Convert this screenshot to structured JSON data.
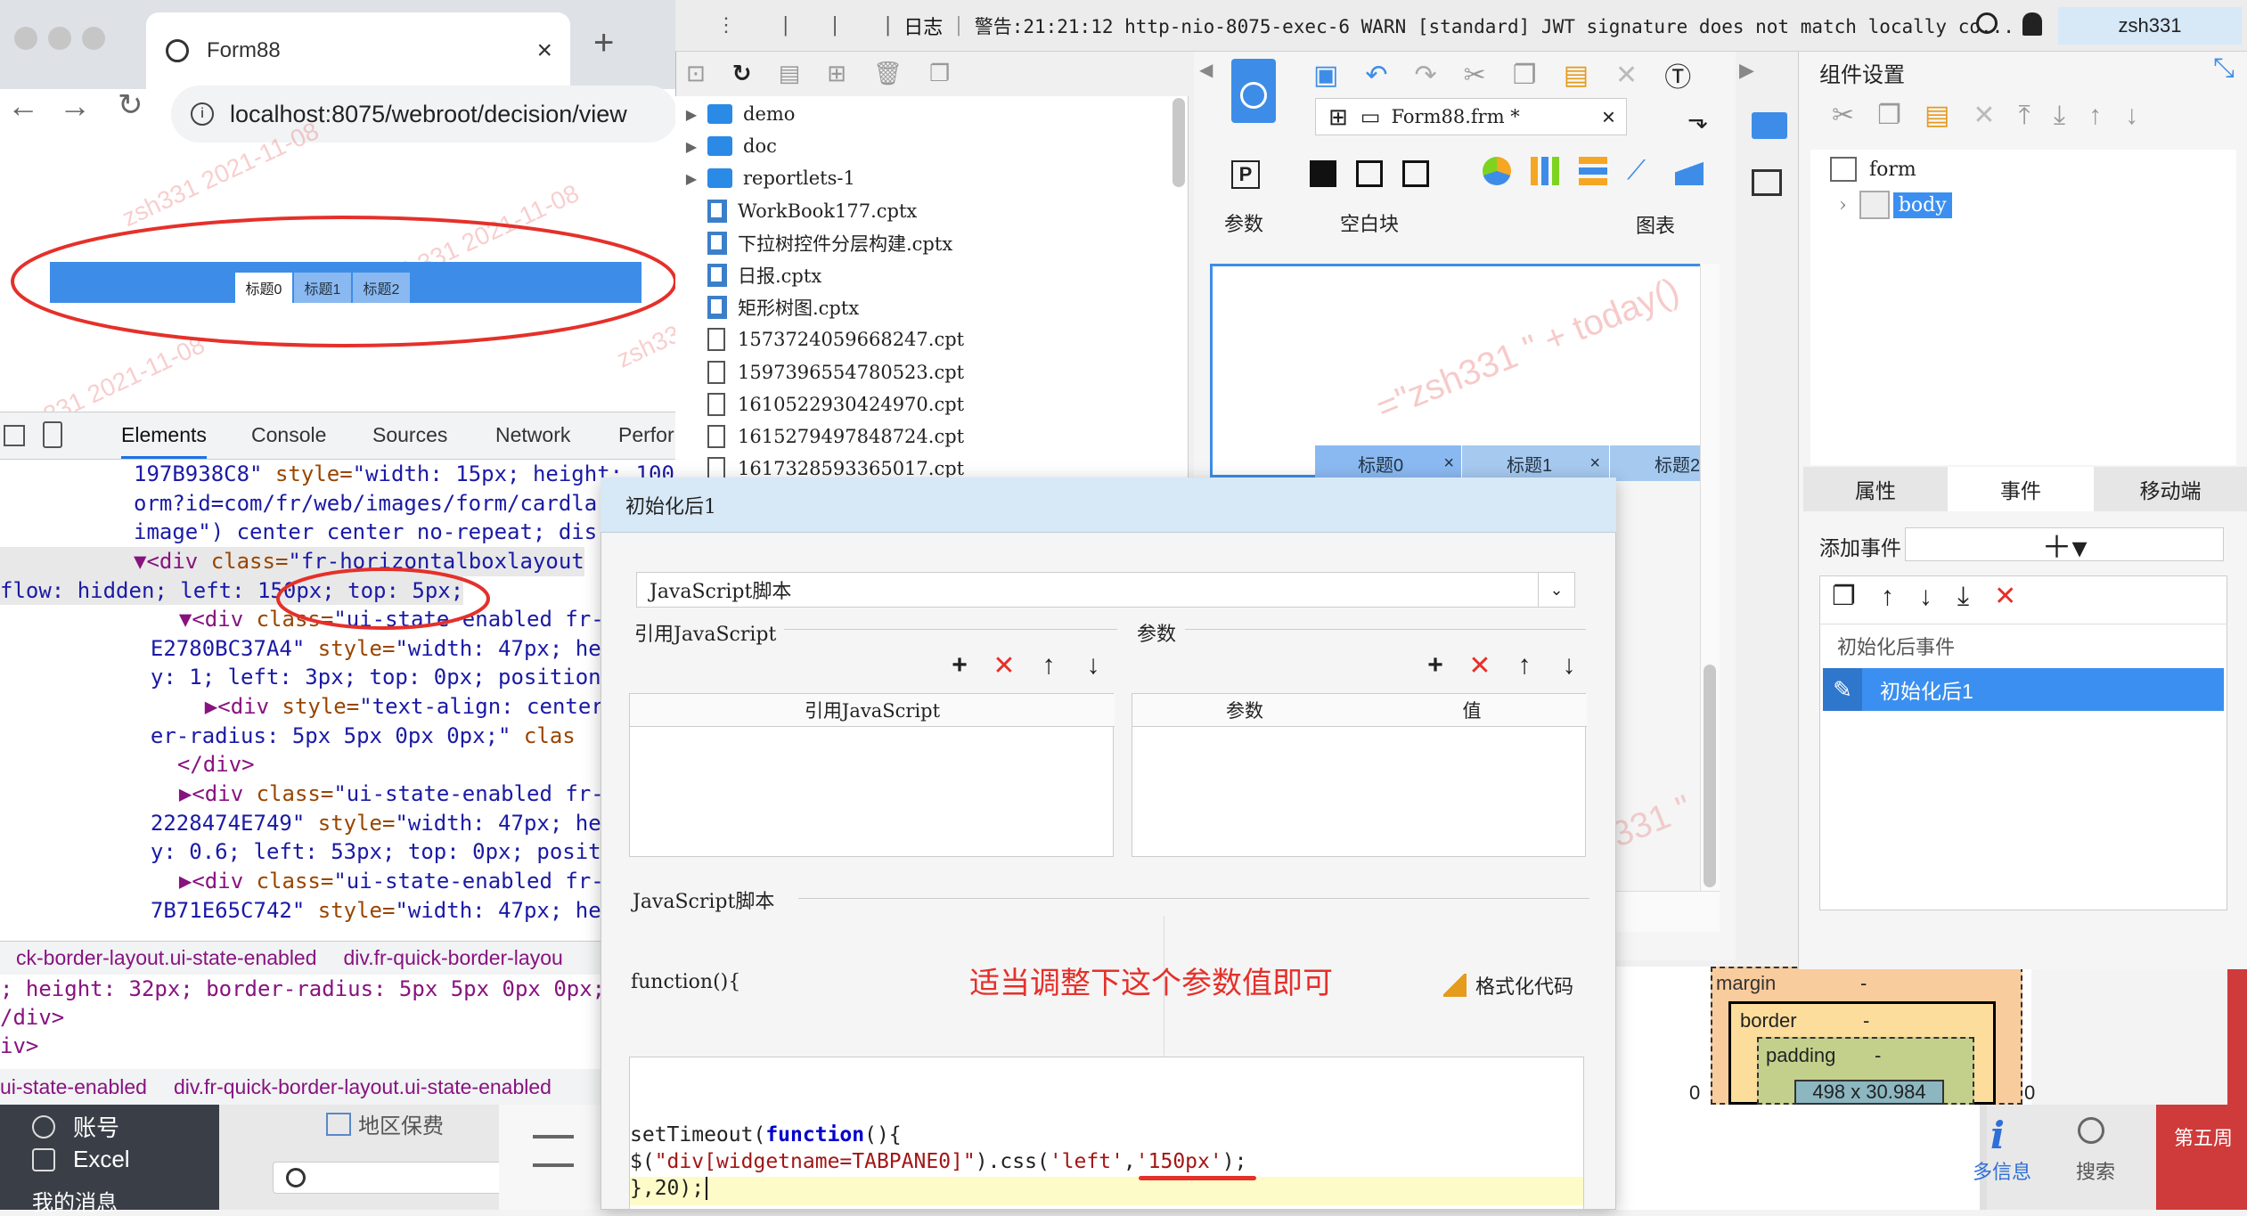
{
  "browser": {
    "tab_title": "Form88",
    "url": "localhost:8075/webroot/decision/view",
    "watermarks": [
      "zsh331 2021-11-08",
      "zsh331 2021-11-08",
      "zsh331 2021-11-08",
      "zsh331"
    ],
    "page_tabs": [
      "标题0",
      "标题1",
      "标题2"
    ],
    "devtools_tabs": [
      "Elements",
      "Console",
      "Sources",
      "Network",
      "Perfor"
    ],
    "code_lines": [
      {
        "parts": [
          [
            "av",
            "197B938C8\""
          ],
          [
            "an",
            " style="
          ],
          [
            "av",
            "\"width: 15px; height: 100"
          ]
        ]
      },
      {
        "parts": [
          [
            "av",
            "orm?id=com/fr/web/images/form/cardla"
          ]
        ]
      },
      {
        "parts": [
          [
            "av",
            "image\") center center no-repeat; dis"
          ]
        ]
      },
      {
        "parts": [
          [
            "tag",
            "▼<div"
          ],
          [
            "an",
            " class="
          ],
          [
            "av",
            "\"fr-horizontalboxlayout"
          ]
        ]
      },
      {
        "parts": [
          [
            "av",
            "flow: hidden; left: 150px; top: 5px;"
          ]
        ]
      },
      {
        "parts": [
          [
            "tag",
            "  ▼<div"
          ],
          [
            "an",
            " class="
          ],
          [
            "av",
            "\"ui-state-enabled fr-f"
          ]
        ]
      },
      {
        "parts": [
          [
            "av",
            "  E2780BC37A4\""
          ],
          [
            "an",
            " style="
          ],
          [
            "av",
            "\"width: 47px; he"
          ]
        ]
      },
      {
        "parts": [
          [
            "av",
            "  y: 1; left: 3px; top: 0px; position"
          ]
        ]
      },
      {
        "parts": [
          [
            "tag",
            "    ▶<div"
          ],
          [
            "an",
            " style="
          ],
          [
            "av",
            "\"text-align: center;"
          ]
        ]
      },
      {
        "parts": [
          [
            "av",
            "  er-radius: 5px 5px 0px 0px;\""
          ],
          [
            "an",
            " clas"
          ]
        ]
      },
      {
        "parts": [
          [
            "tag",
            "  </div>"
          ]
        ]
      },
      {
        "parts": [
          [
            "tag",
            "  ▶<div"
          ],
          [
            "an",
            " class="
          ],
          [
            "av",
            "\"ui-state-enabled fr-f"
          ]
        ]
      },
      {
        "parts": [
          [
            "av",
            "  2228474E749\""
          ],
          [
            "an",
            " style="
          ],
          [
            "av",
            "\"width: 47px; he"
          ]
        ]
      },
      {
        "parts": [
          [
            "av",
            "  y: 0.6; left: 53px; top: 0px; posit"
          ]
        ]
      },
      {
        "parts": [
          [
            "tag",
            "  ▶<div"
          ],
          [
            "an",
            " class="
          ],
          [
            "av",
            "\"ui-state-enabled fr-f"
          ]
        ]
      },
      {
        "parts": [
          [
            "av",
            "  7B71E65C742\""
          ],
          [
            "an",
            " style="
          ],
          [
            "av",
            "\"width: 47px; he"
          ]
        ]
      }
    ],
    "crumb_a": "ck-border-layout.ui-state-enabled",
    "crumb_b": "div.fr-quick-border-layou",
    "lower_lines": [
      "; height: 32px; border-radius: 5px 5px 0px 0px;",
      "/div>",
      "iv>"
    ],
    "crumb_c": "ui-state-enabled",
    "crumb_d": "div.fr-quick-border-layout.ui-state-enabled"
  },
  "taskbar": {
    "account": "账号",
    "excel": "Excel",
    "my_msg": "我的消息",
    "region": "地区保费",
    "info": "多信息",
    "search": "搜索",
    "week": "第五周"
  },
  "designer": {
    "top_log": "警告:21:21:12 http-nio-8075-exec-6 WARN [standard] JWT signature does not match locally co...",
    "top_left_tabs": [
      "日志"
    ],
    "user": "zsh331",
    "tree": [
      {
        "type": "folder",
        "name": "demo"
      },
      {
        "type": "folder",
        "name": "doc"
      },
      {
        "type": "folder",
        "name": "reportlets-1"
      },
      {
        "type": "cptx",
        "name": "WorkBook177.cptx"
      },
      {
        "type": "cptx",
        "name": "下拉树控件分层构建.cptx"
      },
      {
        "type": "cptx",
        "name": "日报.cptx"
      },
      {
        "type": "cptx",
        "name": "矩形树图.cptx"
      },
      {
        "type": "cpt",
        "name": "1573724059668247.cpt"
      },
      {
        "type": "cpt",
        "name": "1597396554780523.cpt"
      },
      {
        "type": "cpt",
        "name": "1610522930424970.cpt"
      },
      {
        "type": "cpt",
        "name": "1615279497848724.cpt"
      },
      {
        "type": "cpt",
        "name": "1617328593365017.cpt"
      }
    ],
    "file_tab": "Form88.frm *",
    "widget_groups": {
      "param": "参数",
      "blank": "空白块",
      "chart": "图表"
    },
    "canvas_tabs": [
      "标题0",
      "标题1",
      "标题2"
    ],
    "canvas_watermark": "=\"zsh331 \" + today()",
    "canvas_watermark2": "331 \""
  },
  "right_panel": {
    "title": "组件设置",
    "tree": [
      "form",
      "body"
    ],
    "tabs": [
      "属性",
      "事件",
      "移动端"
    ],
    "add_event": "添加事件",
    "event_group": "初始化后事件",
    "event_item": "初始化后1",
    "box_labels": {
      "margin": "margin",
      "border": "border",
      "padding": "padding",
      "size": "498 x 30.984",
      "dash": "-",
      "zero": "0"
    }
  },
  "dialog": {
    "title": "初始化后1",
    "type_select": "JavaScript脚本",
    "ref_js_label": "引用JavaScript",
    "param_label": "参数",
    "ref_js_col": "引用JavaScript",
    "param_col": "参数",
    "value_col": "值",
    "script_label": "JavaScript脚本",
    "function_text": "function(){",
    "annotation": "适当调整下这个参数值即可",
    "format_btn": "格式化代码",
    "code": {
      "l1a": "setTimeout(",
      "l1b": "function",
      "l1c": "(){",
      "l2a": "$(",
      "l2b": "\"div[widgetname=TABPANE0]\"",
      "l2c": ").css(",
      "l2d": "'left'",
      "l2e": ",",
      "l2f": "'150px'",
      "l2g": ");",
      "l3": "},20);"
    }
  },
  "colors": {
    "accent": "#3d8de8",
    "annotation": "#e5302a",
    "selection": "#3b8ff0"
  }
}
